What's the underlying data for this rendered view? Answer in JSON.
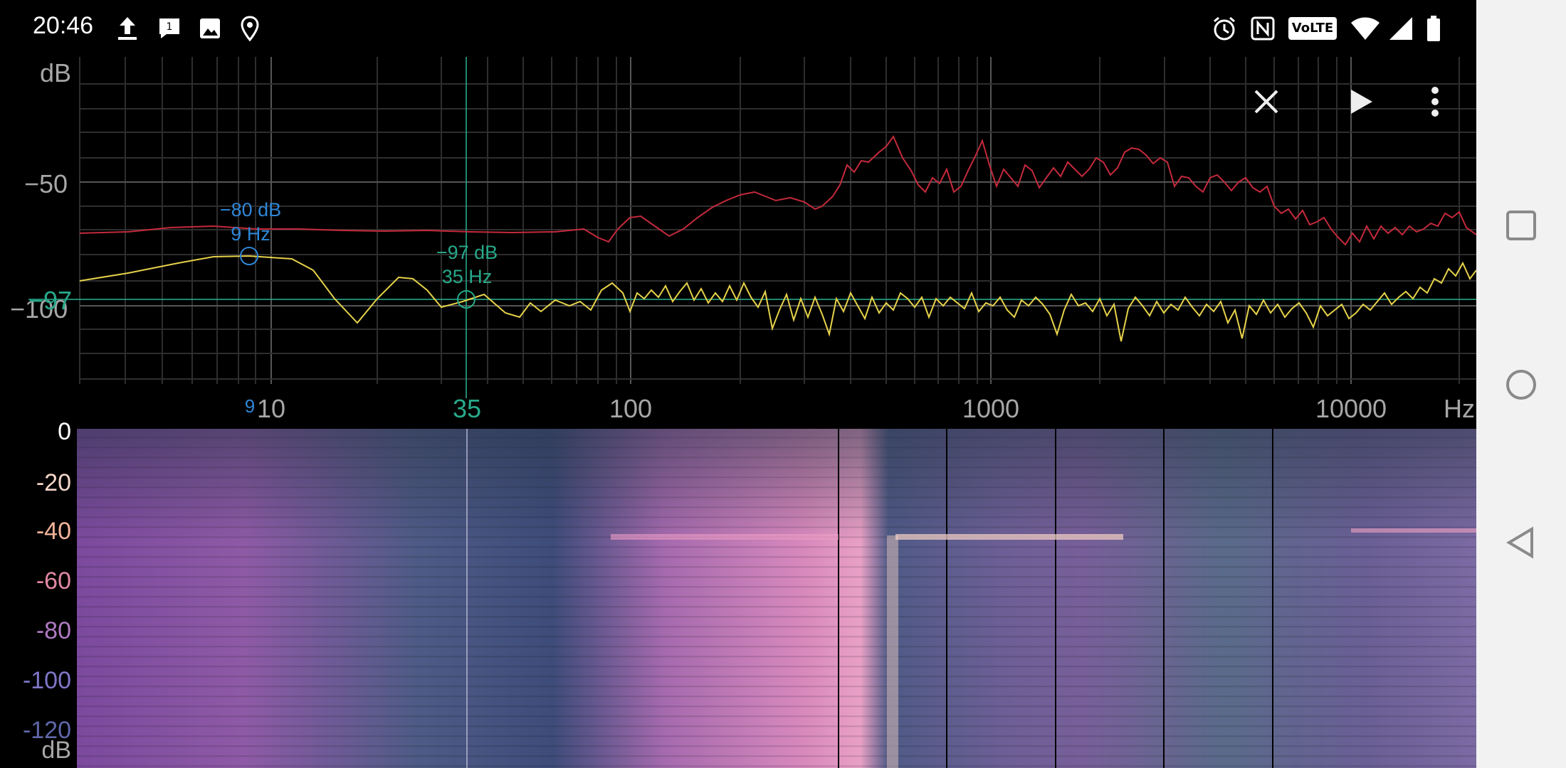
{
  "status_bar": {
    "time": "20:46",
    "left_icons": [
      "upload-icon",
      "message-icon",
      "image-icon",
      "location-icon"
    ],
    "right_icons": [
      "alarm-icon",
      "nfc-icon",
      "volte-icon",
      "wifi-icon",
      "signal-icon",
      "battery-icon"
    ],
    "volte_label": "VoLTE"
  },
  "toolbar": {
    "actions": [
      "close-icon",
      "play-icon",
      "more-icon"
    ]
  },
  "spectrum": {
    "y_unit": "dB",
    "y_ticks": [
      "−50",
      "−100"
    ],
    "x_unit": "Hz",
    "x_ticks": [
      "10",
      "35",
      "100",
      "1000",
      "10000"
    ],
    "marker_freq_small": "9",
    "cursor_db_value": "−97",
    "peak_blue": {
      "db": "−80 dB",
      "hz": "9 Hz",
      "color": "#2f86d6"
    },
    "peak_green": {
      "db": "−97 dB",
      "hz": "35 Hz",
      "color": "#27a98a"
    },
    "trace_colors": {
      "max": "#c42a3c",
      "current": "#e6d24a"
    }
  },
  "spectrogram": {
    "db_scale": [
      {
        "label": "0",
        "color": "#ffffff"
      },
      {
        "label": "-20",
        "color": "#f4d6c8"
      },
      {
        "label": "-40",
        "color": "#f3b49a"
      },
      {
        "label": "-60",
        "color": "#e289a4"
      },
      {
        "label": "-80",
        "color": "#b07ac4"
      },
      {
        "label": "-100",
        "color": "#7f77c9"
      },
      {
        "label": "-120",
        "color": "#5f67a9"
      }
    ],
    "db_unit": "dB"
  }
}
